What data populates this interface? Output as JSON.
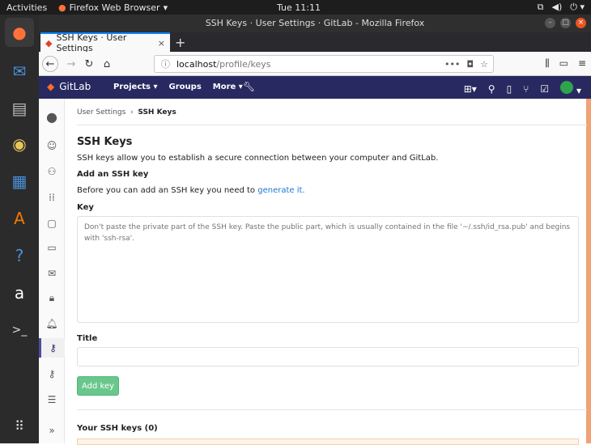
{
  "system": {
    "activities": "Activities",
    "app_name": "Firefox Web Browser",
    "clock": "Tue 11:11"
  },
  "window": {
    "title": "SSH Keys · User Settings · GitLab - Mozilla Firefox"
  },
  "browser": {
    "tab_title": "SSH Keys · User Settings",
    "url_host": "localhost",
    "url_path": "/profile/keys"
  },
  "gitlab": {
    "brand": "GitLab",
    "menu": [
      "Projects",
      "Groups",
      "More"
    ]
  },
  "breadcrumb": {
    "parent": "User Settings",
    "current": "SSH Keys"
  },
  "page": {
    "heading": "SSH Keys",
    "description": "SSH keys allow you to establish a secure connection between your computer and GitLab.",
    "add_heading": "Add an SSH key",
    "generate_prefix": "Before you can add an SSH key you need to ",
    "generate_link": "generate it.",
    "key_label": "Key",
    "key_placeholder": "Don't paste the private part of the SSH key. Paste the public part, which is usually contained in the file '~/.ssh/id_rsa.pub' and begins with 'ssh-rsa'.",
    "title_label": "Title",
    "title_value": "",
    "add_button": "Add key",
    "your_keys": "Your SSH keys (0)"
  },
  "colors": {
    "gitlab_header": "#292961",
    "accent_orange": "#f2a274",
    "button_green": "#69c78c",
    "link_blue": "#1f78d1"
  }
}
